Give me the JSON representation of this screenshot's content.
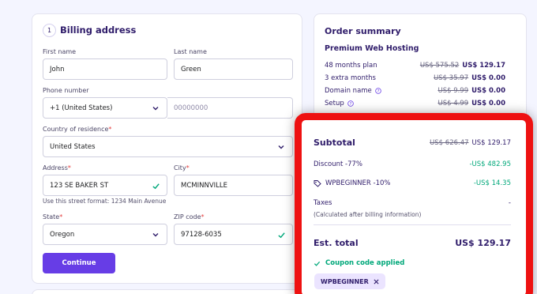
{
  "billing": {
    "step_number": "1",
    "title": "Billing address",
    "first_name": {
      "label": "First name",
      "value": "John"
    },
    "last_name": {
      "label": "Last name",
      "value": "Green"
    },
    "phone": {
      "label": "Phone number",
      "country": "+1 (United States)",
      "placeholder": "00000000"
    },
    "country": {
      "label": "Country of residence",
      "required": "*",
      "value": "United States"
    },
    "address": {
      "label": "Address",
      "required": "*",
      "value": "123 SE BAKER ST",
      "hint": "Use this street format: 1234 Main Avenue"
    },
    "city": {
      "label": "City",
      "required": "*",
      "value": "MCMINNVILLE"
    },
    "state": {
      "label": "State",
      "required": "*",
      "value": "Oregon"
    },
    "zip": {
      "label": "ZIP code",
      "required": "*",
      "value": "97128-6035"
    },
    "continue_label": "Continue"
  },
  "summary": {
    "title": "Order summary",
    "plan_name": "Premium Web Hosting",
    "rows": [
      {
        "name": "48 months plan",
        "old": "US$ 575.52",
        "new": "US$ 129.17"
      },
      {
        "name": "3 extra months",
        "old": "US$ 35.97",
        "new": "US$ 0.00"
      },
      {
        "name": "Domain name",
        "old": "US$ 9.99",
        "new": "US$ 0.00"
      },
      {
        "name": "Setup",
        "old": "US$ 4.99",
        "new": "US$ 0.00"
      }
    ]
  },
  "totals": {
    "subtotal_label": "Subtotal",
    "subtotal_old": "US$ 626.47",
    "subtotal_new": "US$ 129.17",
    "discount_label": "Discount -77%",
    "discount_value": "-US$ 482.95",
    "coupon_label": "WPBEGINNER -10%",
    "coupon_value": "-US$ 14.35",
    "taxes_label": "Taxes",
    "taxes_value": "-",
    "taxes_note": "(Calculated after billing information)",
    "est_label": "Est. total",
    "est_value": "US$ 129.17",
    "applied_text": "Coupon code applied",
    "chip_label": "WPBEGINNER"
  },
  "colors": {
    "accent": "#673de6",
    "highlight": "#ee1111",
    "success": "#00a87a",
    "text": "#2f1c6a"
  }
}
